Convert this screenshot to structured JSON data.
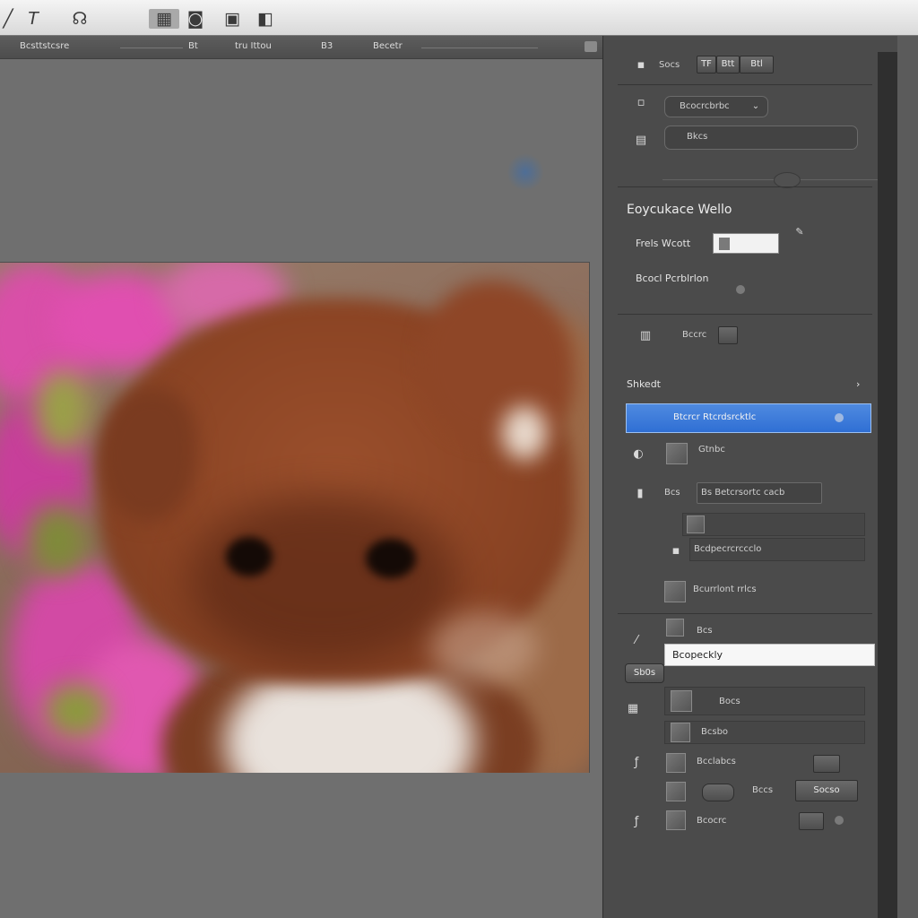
{
  "toolbar": {
    "icons": [
      "text-tool-icon",
      "lasso-tool-icon",
      "layers-icon",
      "camera-icon",
      "crop-icon",
      "frame-icon"
    ]
  },
  "document_tab": {
    "title": "Bcsttstcsre",
    "field_1": "Bt",
    "field_2": "tru Ittou",
    "field_3": "B3",
    "field_4": "Becetr"
  },
  "canvas": {
    "image_subject": "kitten-photo"
  },
  "panel": {
    "top_label": "Socs",
    "top_btn_1": "TF",
    "top_btn_2": "Btt",
    "top_btn_3": "Btl",
    "field_1": "Bcocrcbrbc",
    "field_2": "Bkcs",
    "section_title": "Eoycukace  Wello",
    "frels_label": "Frels Wcott",
    "frels_value": "",
    "position_label": "Bcocl Pcrblrlon",
    "mid_label": "Bccrc",
    "sheet_label": "Shkedt",
    "selected_item": "Btcrcr Rtcrdsrcktlc",
    "row_1": "Gtnbc",
    "row_2_label": "Bcs",
    "row_2_value": "Bs Betcrsortc  cacb",
    "row_3": "Bcdpecrcrccclo",
    "row_4": "Bcurrlont rrlcs",
    "row_5": "Bcs",
    "dropdown_item": "Bcopeckly",
    "side_tag": "Sb0s",
    "row_6": "Bocs",
    "row_7": "Bcsbo",
    "row_8": "Bcclabcs",
    "row_9_mid": "Bccs",
    "row_9_btn": "Socso",
    "row_10": "Bcocrc"
  },
  "colors": {
    "selection": "#2f6fd4",
    "panel_bg": "#4b4b4b",
    "canvas_bg": "#6f6f6f"
  }
}
